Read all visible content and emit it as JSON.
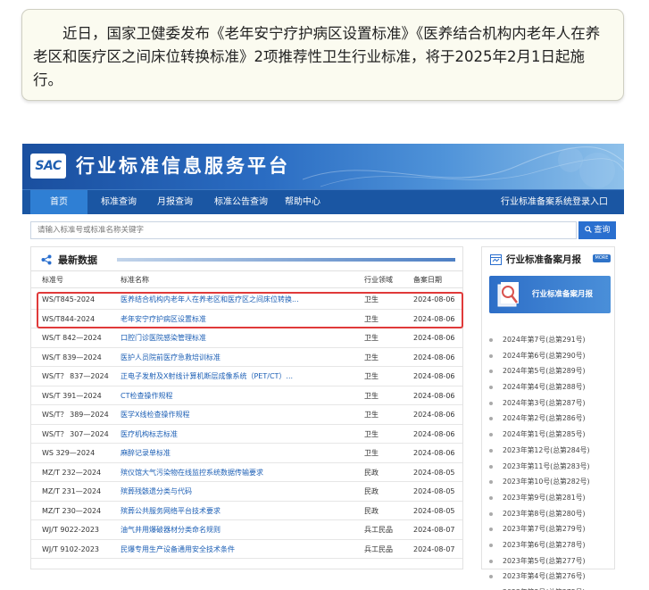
{
  "note": {
    "text": "近日，国家卫健委发布《老年安宁疗护病区设置标准》《医养结合机构内老年人在养老区和医疗区之间床位转换标准》2项推荐性卫生行业标准，将于2025年2月1日起施行。"
  },
  "site": {
    "logo": "SAC",
    "title": "行业标准信息服务平台"
  },
  "nav": {
    "items": [
      "首页",
      "标准查询",
      "月报查询",
      "标准公告查询",
      "帮助中心"
    ],
    "right": "行业标准备案系统登录入口"
  },
  "search": {
    "placeholder": "请输入标准号或标准名称关键字",
    "button": "查询"
  },
  "latest": {
    "title": "最新数据",
    "columns": [
      "标准号",
      "标准名称",
      "行业领域",
      "备案日期"
    ],
    "rows": [
      {
        "no": "WS/T845-2024",
        "name": "医养结合机构内老年人在养老区和医疗区之间床位转换...",
        "field": "卫生",
        "date": "2024-08-06"
      },
      {
        "no": "WS/T844-2024",
        "name": "老年安宁疗护病区设置标准",
        "field": "卫生",
        "date": "2024-08-06"
      },
      {
        "no": "WS/T 842—2024",
        "name": "口腔门诊医院感染管理标准",
        "field": "卫生",
        "date": "2024-08-06"
      },
      {
        "no": "WS/T 839—2024",
        "name": "医护人员院前医疗急救培训标准",
        "field": "卫生",
        "date": "2024-08-06"
      },
      {
        "no": "WS/T？ 837—2024",
        "name": "正电子发射及X射线计算机断层成像系统（PET/CT）...",
        "field": "卫生",
        "date": "2024-08-06"
      },
      {
        "no": "WS/T 391—2024",
        "name": "CT检查操作规程",
        "field": "卫生",
        "date": "2024-08-06"
      },
      {
        "no": "WS/T？ 389—2024",
        "name": "医学X线检查操作规程",
        "field": "卫生",
        "date": "2024-08-06"
      },
      {
        "no": "WS/T？ 307—2024",
        "name": "医疗机构标志标准",
        "field": "卫生",
        "date": "2024-08-06"
      },
      {
        "no": "WS 329—2024",
        "name": "麻醉记录单标准",
        "field": "卫生",
        "date": "2024-08-06"
      },
      {
        "no": "MZ/T 232—2024",
        "name": "殡仪馆大气污染物在线监控系统数据传输要求",
        "field": "民政",
        "date": "2024-08-05"
      },
      {
        "no": "MZ/T 231—2024",
        "name": "殡葬残骸遗分类与代码",
        "field": "民政",
        "date": "2024-08-05"
      },
      {
        "no": "MZ/T 230—2024",
        "name": "殡葬公共服务网络平台技术要求",
        "field": "民政",
        "date": "2024-08-05"
      },
      {
        "no": "WJ/T 9022-2023",
        "name": "油气井用爆破器材分类命名规则",
        "field": "兵工民品",
        "date": "2024-08-07"
      },
      {
        "no": "WJ/T 9102-2023",
        "name": "民爆专用生产设备通用安全技术条件",
        "field": "兵工民品",
        "date": "2024-08-07"
      }
    ]
  },
  "monthly": {
    "title": "行业标准备案月报",
    "more": "MORE +",
    "banner": "行业标准备案月报",
    "items": [
      "2024年第7号(总第291号)",
      "2024年第6号(总第290号)",
      "2024年第5号(总第289号)",
      "2024年第4号(总第288号)",
      "2024年第3号(总第287号)",
      "2024年第2号(总第286号)",
      "2024年第1号(总第285号)",
      "2023年第12号(总第284号)",
      "2023年第11号(总第283号)",
      "2023年第10号(总第282号)",
      "2023年第9号(总第281号)",
      "2023年第8号(总第280号)",
      "2023年第7号(总第279号)",
      "2023年第6号(总第278号)",
      "2023年第5号(总第277号)",
      "2023年第4号(总第276号)",
      "2023年第3号(总第275号)"
    ]
  },
  "colors": {
    "nav_bg": "#1a56a3",
    "link": "#1c5fb5",
    "highlight": "#e03a3a",
    "note_bg": "#fbfbf0"
  }
}
